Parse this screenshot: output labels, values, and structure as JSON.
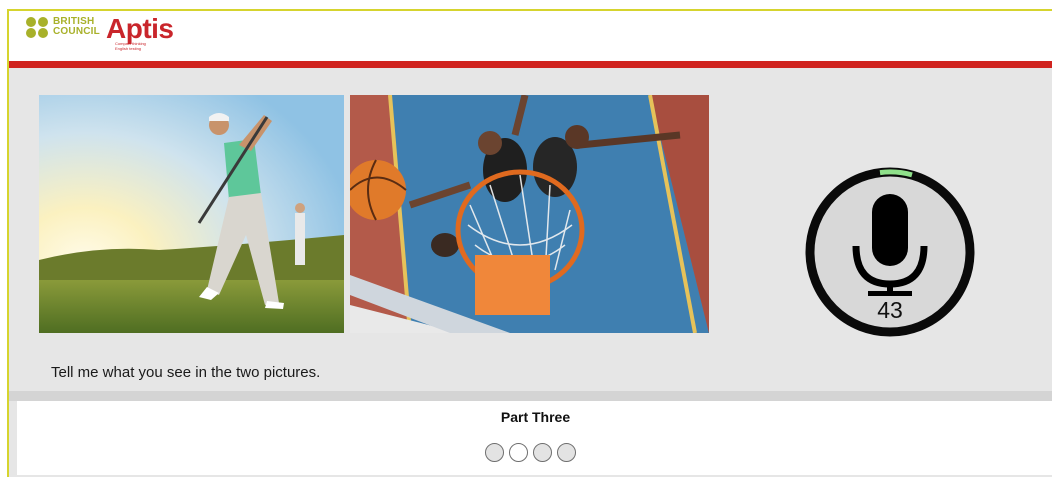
{
  "header": {
    "brand_line1": "BRITISH",
    "brand_line2": "COUNCIL",
    "product": "Aptis",
    "tagline": "Compact thinking English testing",
    "brand_color": "#a8b12a",
    "accent_color": "#d0231f"
  },
  "pictures": [
    {
      "name": "golfer-picture"
    },
    {
      "name": "basketball-picture"
    }
  ],
  "recorder": {
    "icon": "microphone-icon",
    "countdown": "43"
  },
  "question": {
    "prompt": "Tell me what you see in the two pictures."
  },
  "footer": {
    "part_title": "Part Three",
    "progress_dots": [
      {
        "state": "answered"
      },
      {
        "state": "current"
      },
      {
        "state": "answered"
      },
      {
        "state": "answered"
      }
    ]
  }
}
